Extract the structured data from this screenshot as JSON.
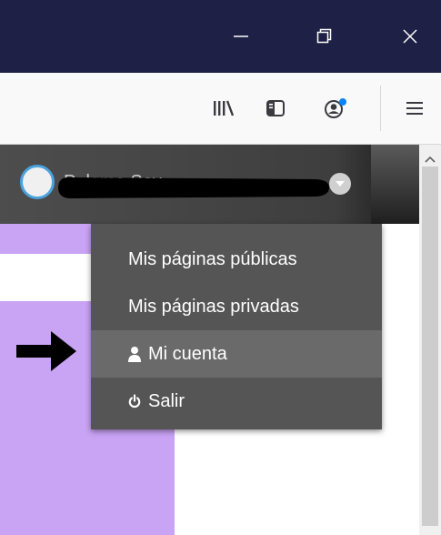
{
  "user": {
    "name": "Paloma Soy"
  },
  "menu": {
    "items": [
      {
        "label": "Mis páginas públicas",
        "icon": "none"
      },
      {
        "label": "Mis páginas privadas",
        "icon": "none"
      },
      {
        "label": "Mi cuenta",
        "icon": "user-icon"
      },
      {
        "label": "Salir",
        "icon": "power-icon"
      }
    ]
  },
  "colors": {
    "titlebar": "#1e2145",
    "user_bar": "#4d4d4d",
    "dropdown": "#555555",
    "dropdown_hover": "#6a6a6a",
    "panel_purple": "#c9a3f4",
    "notification_dot": "#0a84ff"
  }
}
